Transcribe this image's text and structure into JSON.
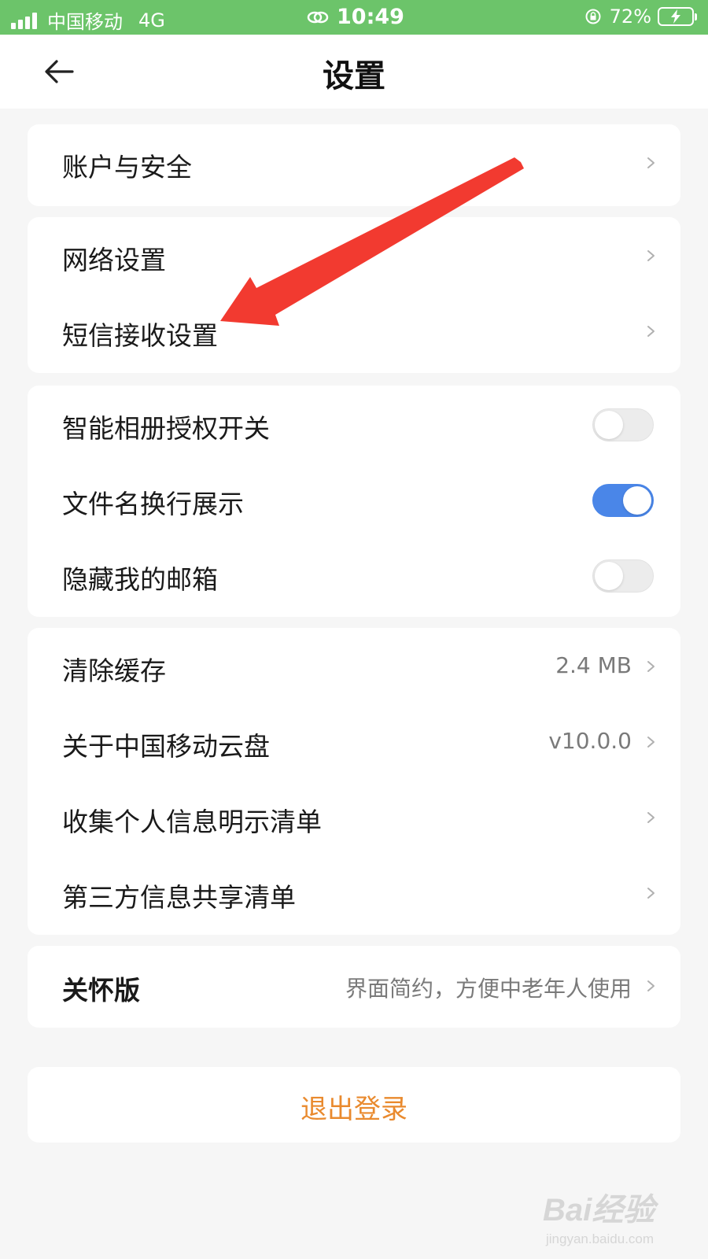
{
  "status_bar": {
    "carrier": "中国移动",
    "network": "4G",
    "time": "10:49",
    "battery": "72%"
  },
  "header": {
    "title": "设置"
  },
  "groups": [
    {
      "rows": [
        {
          "label": "账户与安全"
        }
      ]
    },
    {
      "rows": [
        {
          "label": "网络设置"
        },
        {
          "label": "短信接收设置"
        }
      ]
    },
    {
      "rows": [
        {
          "label": "智能相册授权开关",
          "toggle": "off"
        },
        {
          "label": "文件名换行展示",
          "toggle": "on"
        },
        {
          "label": "隐藏我的邮箱",
          "toggle": "off"
        }
      ]
    },
    {
      "rows": [
        {
          "label": "清除缓存",
          "value": "2.4 MB"
        },
        {
          "label": "关于中国移动云盘",
          "value": "v10.0.0"
        },
        {
          "label": "收集个人信息明示清单"
        },
        {
          "label": "第三方信息共享清单"
        }
      ]
    },
    {
      "rows": [
        {
          "label": "关怀版",
          "value": "界面简约，方便中老年人使用"
        }
      ]
    }
  ],
  "logout": {
    "label": "退出登录"
  },
  "colors": {
    "status_bar": "#6cc46a",
    "toggle_on": "#4a86e8",
    "logout_text": "#e98a2e",
    "annotation_arrow": "#f23a30"
  },
  "watermark": {
    "brand": "Bai经验",
    "sub": "jingyan.baidu.com"
  }
}
